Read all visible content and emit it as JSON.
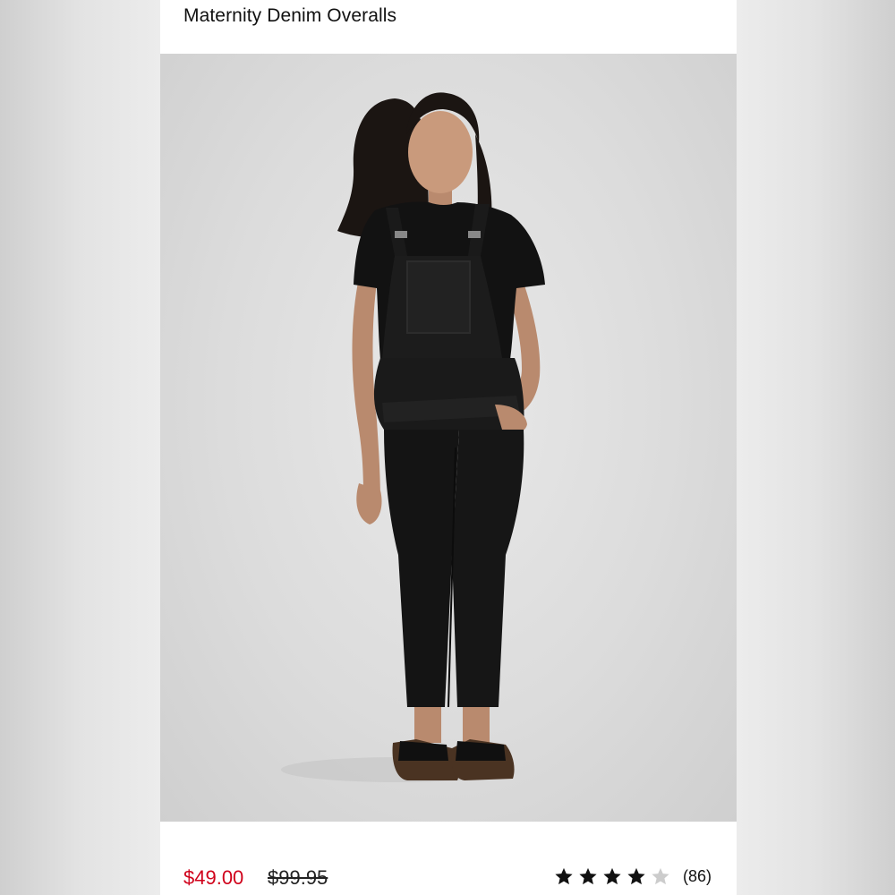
{
  "product": {
    "title": "Maternity Denim Overalls",
    "price_sale": "$49.00",
    "price_original": "$99.95",
    "rating": 4,
    "rating_max": 5,
    "review_count": "(86)"
  },
  "carousel": {
    "total": 4,
    "active_index": 0
  },
  "colors": {
    "sale_price": "#d0021b",
    "star_filled": "#111111",
    "star_empty": "#cccccc"
  },
  "image": {
    "subject": "model-wearing-black-denim-overalls"
  }
}
